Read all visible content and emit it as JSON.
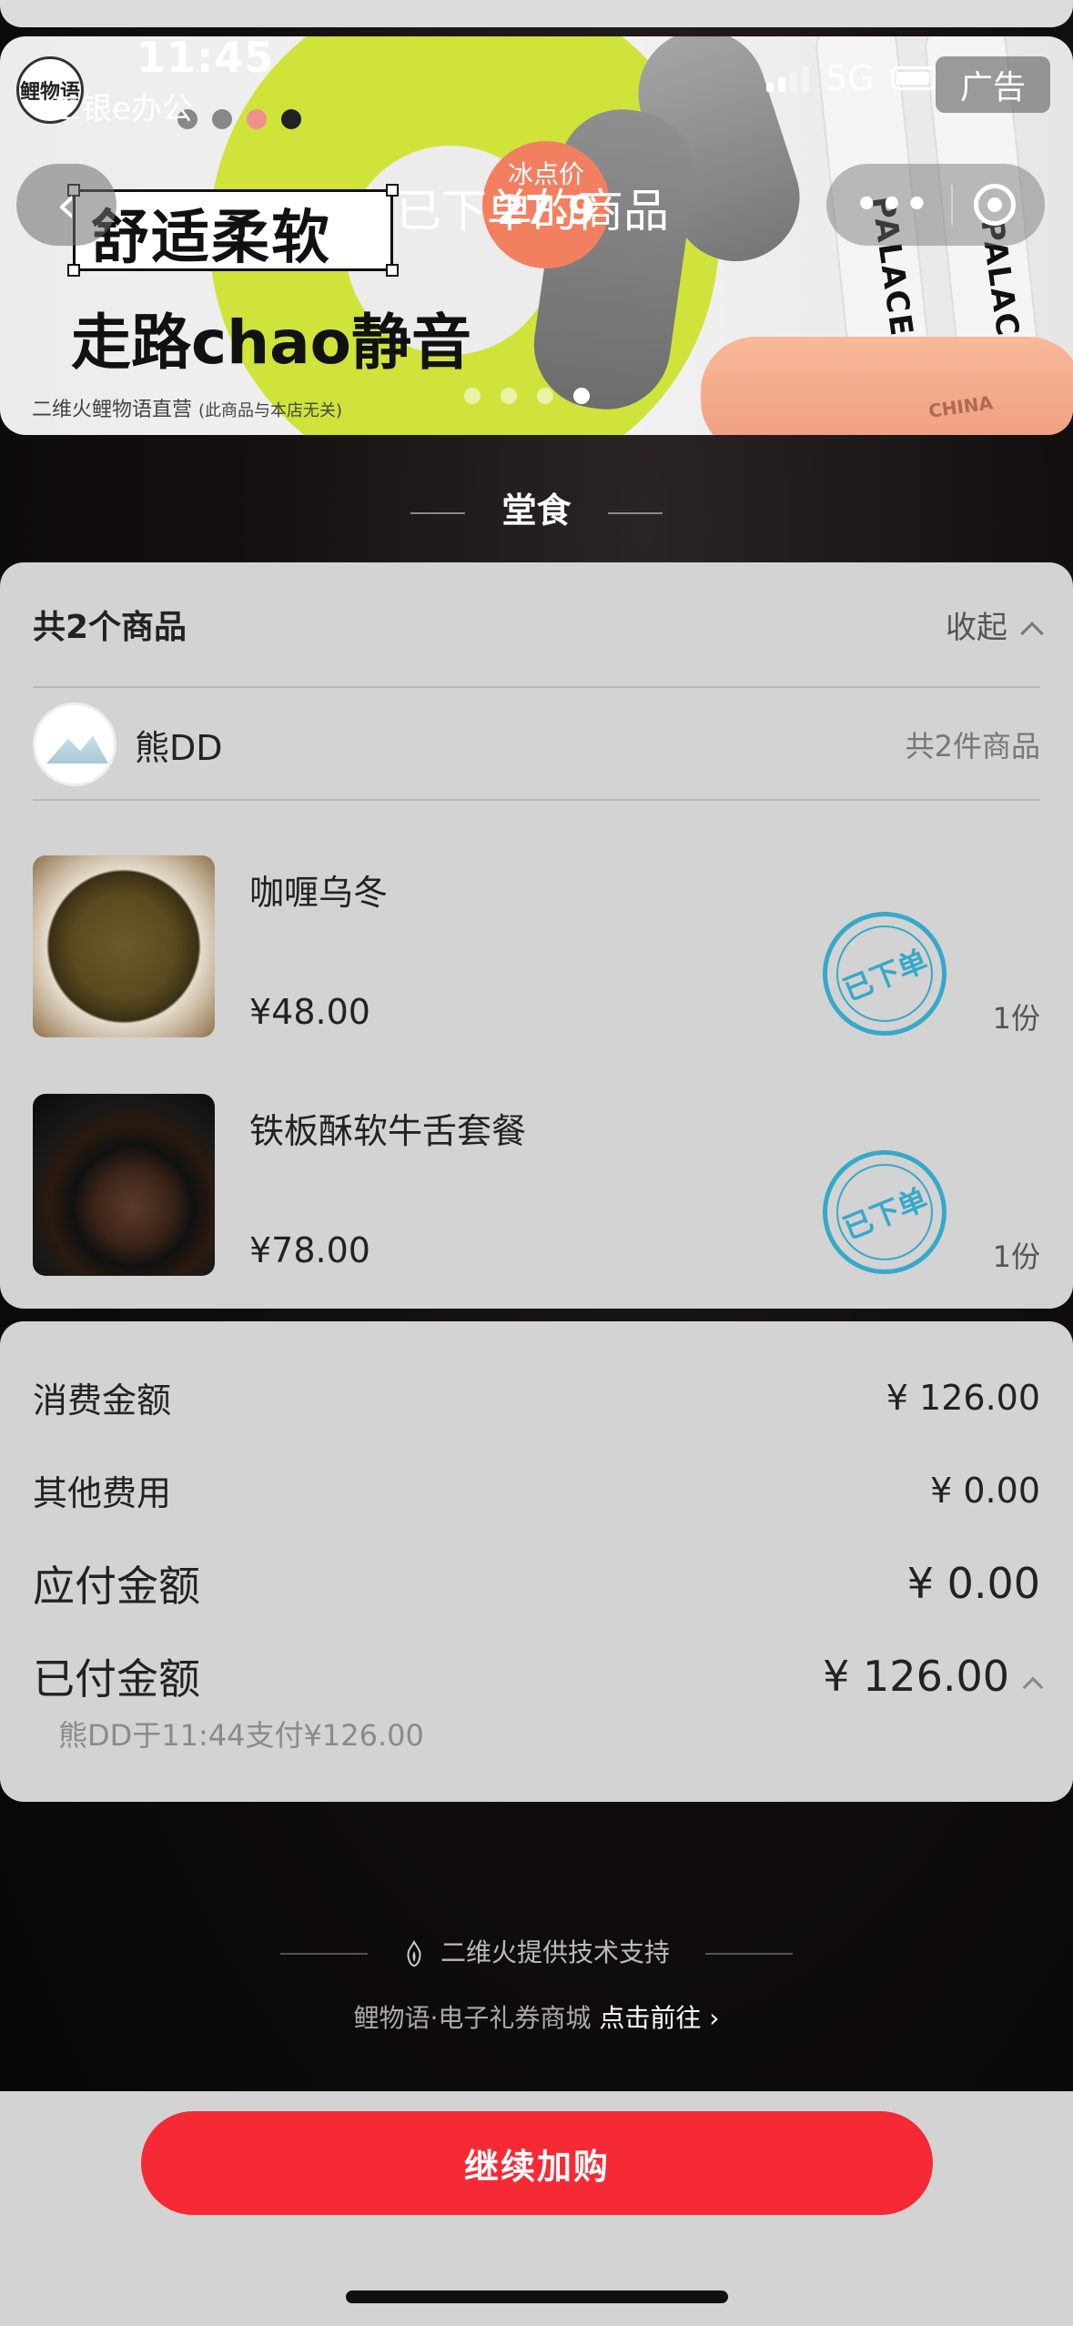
{
  "status_bar": {
    "time": "11:45",
    "carrier_sub": "工银e办公",
    "network": "5G"
  },
  "ad": {
    "tag": "广告",
    "headline": "舒适柔软",
    "subline": "走路chao静音",
    "brand_footer": "二维火鲤物语直营",
    "footer_note": "(此商品与本店无关)",
    "price_badge_label": "冰点价",
    "price_badge_value": "27.9",
    "logo_text": "鲤物语",
    "sock_text": "PALACE",
    "sole_text": "CHINA",
    "carousel_count": 4,
    "carousel_active_index": 3
  },
  "nav": {
    "back_label": "‹",
    "title": "已下单的商品",
    "more_label": "•••"
  },
  "section": {
    "heading": "堂食"
  },
  "order": {
    "header_title": "共2个商品",
    "collapse_label": "收起",
    "user": {
      "name": "熊DD",
      "count_label": "共2件商品"
    },
    "items": [
      {
        "name": "咖喱乌冬",
        "price": "¥48.00",
        "qty": "1份",
        "stamp": "已下单",
        "image": "curry-udon"
      },
      {
        "name": "铁板酥软牛舌套餐",
        "price": "¥78.00",
        "qty": "1份",
        "stamp": "已下单",
        "image": "beef-tongue-set"
      }
    ]
  },
  "fees": {
    "consumption_label": "消费金额",
    "consumption_value": "¥ 126.00",
    "other_label": "其他费用",
    "other_value": "¥ 0.00",
    "payable_label": "应付金额",
    "payable_value": "¥ 0.00",
    "paid_label": "已付金额",
    "paid_value": "¥ 126.00",
    "paid_note": "熊DD于11:44支付¥126.00"
  },
  "footer": {
    "support_text": "二维火提供技术支持",
    "mall_text": "鲤物语·电子礼券商城",
    "mall_link": "点击前往 ›"
  },
  "cta": {
    "label": "继续加购"
  },
  "colors": {
    "cta": "#f52a35",
    "stamp": "#36a9c9",
    "card_bg": "#d3d3d3",
    "page_bg": "#0d0a0a"
  }
}
